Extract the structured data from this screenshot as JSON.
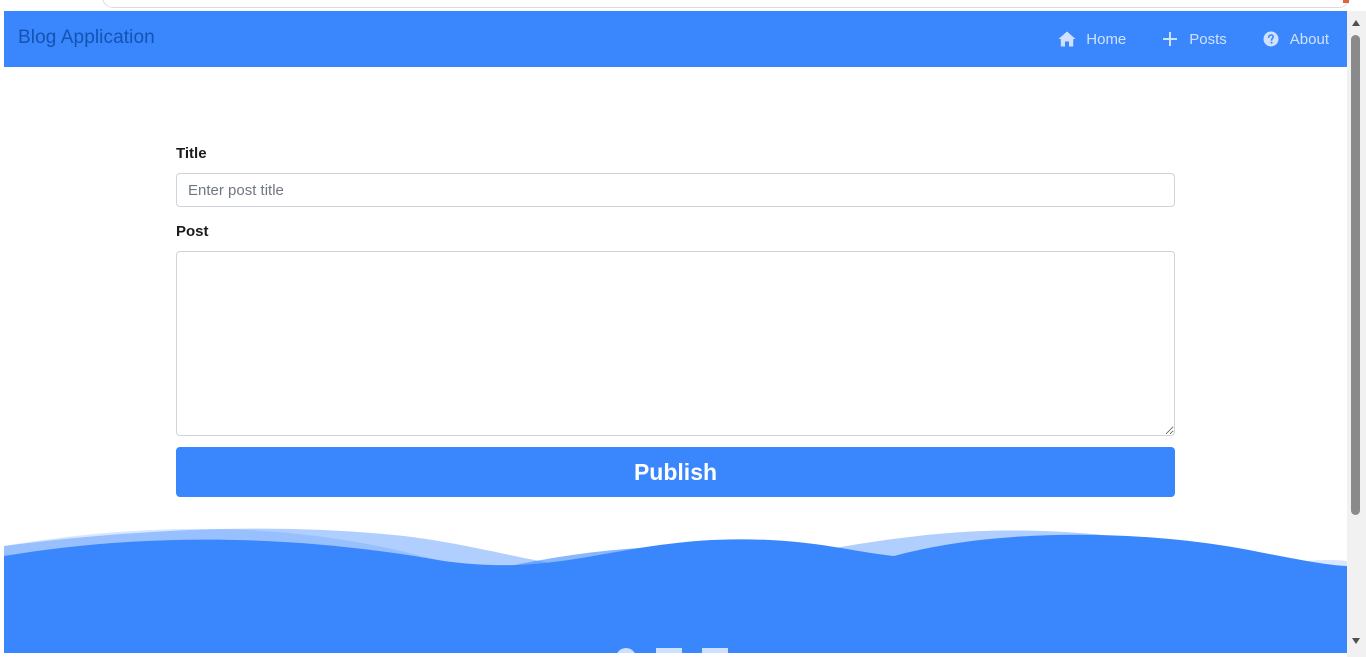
{
  "navbar": {
    "brand": "Blog Application",
    "links": [
      {
        "label": "Home",
        "icon": "home-icon"
      },
      {
        "label": "Posts",
        "icon": "plus-icon"
      },
      {
        "label": "About",
        "icon": "question-circle-icon"
      }
    ]
  },
  "form": {
    "title_label": "Title",
    "title_placeholder": "Enter post title",
    "title_value": "",
    "post_label": "Post",
    "post_value": "",
    "publish_label": "Publish"
  },
  "colors": {
    "primary": "#3a87fd",
    "brand_text": "#1452b3",
    "nav_text": "#cfe1ff"
  }
}
